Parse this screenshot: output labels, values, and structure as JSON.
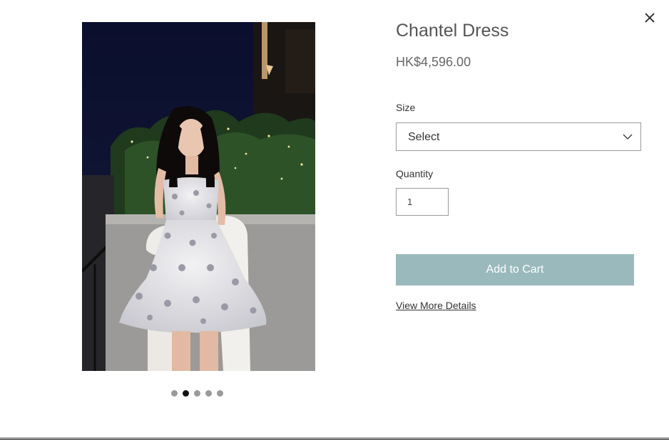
{
  "product": {
    "title": "Chantel Dress",
    "price": "HK$4,596.00",
    "image_alt": "Chantel Dress"
  },
  "gallery": {
    "dot_count": 5,
    "active_index": 1
  },
  "size": {
    "label": "Size",
    "selected": "Select",
    "icon": "chevron-down-icon"
  },
  "quantity": {
    "label": "Quantity",
    "value": "1"
  },
  "actions": {
    "add_to_cart": "Add to Cart",
    "view_details": "View More Details",
    "close_icon": "close-icon"
  },
  "colors": {
    "button": "#9ab9bc",
    "active_dot": "#111111",
    "inactive_dot": "#9a9a9a"
  }
}
